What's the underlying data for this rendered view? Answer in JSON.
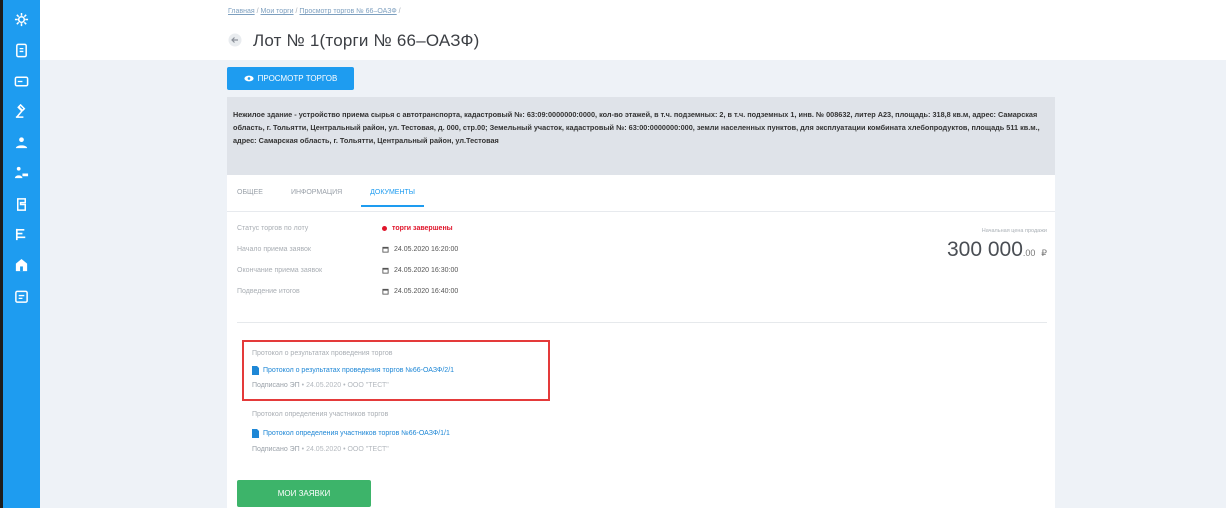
{
  "sidebar": {
    "icons": [
      "gear-icon",
      "document-icon",
      "card-icon",
      "hammer-icon",
      "user-group-icon",
      "handshake-icon",
      "clipboard-icon",
      "list-icon",
      "building-icon",
      "calendar-icon"
    ]
  },
  "breadcrumb": {
    "items": [
      "Главная",
      "Мои торги",
      "Просмотр торгов № 66–ОАЗФ"
    ],
    "separator": "/"
  },
  "page": {
    "title": "Лот № 1(торги № 66–ОАЗФ)"
  },
  "actions": {
    "view_auction_label": "ПРОСМОТР ТОРГОВ",
    "my_applications_label": "МОИ ЗАЯВКИ"
  },
  "lot": {
    "description": "Нежилое здание - устройство приема сырья с автотранспорта, кадастровый №: 63:09:0000000:0000, кол-во этажей, в т.ч. подземных: 2, в т.ч. подземных 1, инв. № 008632, литер А23, площадь: 318,8 кв.м, адрес: Самарская область, г. Тольятти, Центральный район, ул. Тестовая, д. 000, стр.00; Земельный участок, кадастровый №: 63:00:0000000:000, земли населенных пунктов, для эксплуатации комбината хлебопродуктов, площадь 511 кв.м., адрес: Самарская область, г. Тольятти, Центральный район, ул.Тестовая"
  },
  "tabs": [
    {
      "label": "ОБЩЕЕ"
    },
    {
      "label": "ИНФОРМАЦИЯ"
    },
    {
      "label": "ДОКУМЕНТЫ"
    }
  ],
  "active_tab": "ДОКУМЕНТЫ",
  "details": {
    "status_label": "Статус торгов по лоту",
    "status_value": "торги завершены",
    "start_label": "Начало приема заявок",
    "start_value": "24.05.2020 16:20:00",
    "end_label": "Окончание приема заявок",
    "end_value": "24.05.2020 16:30:00",
    "summary_label": "Подведение итогов",
    "summary_value": "24.05.2020 16:40:00"
  },
  "price": {
    "label": "Начальная цена продажи",
    "value": "300 000",
    "cents": ".00",
    "currency": "₽"
  },
  "documents": [
    {
      "heading": "Протокол о результатах проведения торгов",
      "link": "Протокол о результатах проведения торгов №66-ОАЗФ/2/1",
      "signed": "Подписано ЭП",
      "date": "24.05.2020",
      "signer": "ООО \"ТЕСТ\""
    },
    {
      "heading": "Протокол определения участников торгов",
      "link": "Протокол определения участников торгов №66-ОАЗФ/1/1",
      "signed": "Подписано ЭП",
      "date": "24.05.2020",
      "signer": "ООО \"ТЕСТ\""
    }
  ],
  "colors": {
    "sidebar": "#1e9cf0",
    "accent": "#1e9cf0",
    "status": "#e0152b",
    "success_button": "#3db46a",
    "highlight": "#e43a3a"
  }
}
